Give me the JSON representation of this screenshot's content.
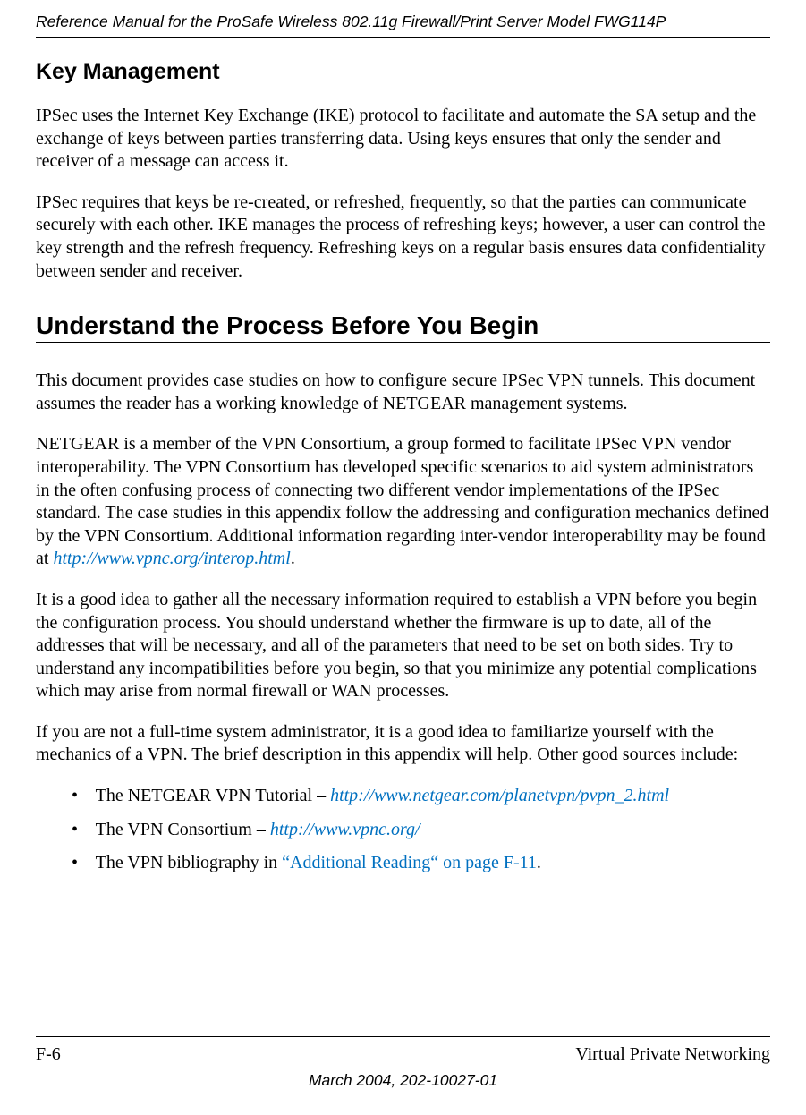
{
  "header": {
    "runningTitle": "Reference Manual for the ProSafe Wireless 802.11g  Firewall/Print Server Model FWG114P"
  },
  "sections": {
    "keyMgmt": {
      "heading": "Key Management",
      "p1": "IPSec uses the Internet Key Exchange (IKE) protocol to facilitate and automate the SA setup and the exchange of keys between parties transferring data. Using keys ensures that only the sender and receiver of a message can access it.",
      "p2": "IPSec requires that keys be re-created, or refreshed, frequently, so that the parties can communicate securely with each other. IKE manages the process of refreshing keys; however, a user can control the key strength and the refresh frequency. Refreshing keys on a regular basis ensures data confidentiality between sender and receiver."
    },
    "understand": {
      "heading": "Understand the Process Before You Begin",
      "p1": "This document provides case studies on how to configure secure IPSec VPN tunnels. This document assumes the reader has a working knowledge of NETGEAR management systems.",
      "p2a": "NETGEAR is a member of the VPN Consortium, a group formed to facilitate IPSec VPN vendor interoperability. The VPN Consortium has developed specific scenarios to aid system administrators in the often confusing process of connecting two different vendor implementations of the IPSec standard. The case studies in this appendix follow the addressing and configuration mechanics defined by the VPN Consortium. Additional information regarding inter-vendor interoperability may be found at ",
      "p2_link": "http://www.vpnc.org/interop.html",
      "p2b": ".",
      "p3": "It is a good idea to gather all the necessary information required to establish a VPN before you begin the configuration process. You should understand whether the firmware is up to date, all of the addresses that will be necessary, and all of the parameters that need to be set on both sides. Try to understand any incompatibilities before you begin, so that you minimize any potential complications which may arise from normal firewall or WAN processes.",
      "p4": "If you are not a full-time system administrator, it is a good idea to familiarize yourself with the mechanics of a VPN. The brief description in this appendix will help. Other good sources include:",
      "bullets": {
        "b1a": "The NETGEAR VPN Tutorial – ",
        "b1_link": "http://www.netgear.com/planetvpn/pvpn_2.html",
        "b2a": "The VPN Consortium – ",
        "b2_link": "http://www.vpnc.org/",
        "b3a": "The VPN bibliography in ",
        "b3_xref": "“Additional Reading“ on page F-11",
        "b3b": "."
      }
    }
  },
  "footer": {
    "pageNum": "F-6",
    "sectionTitle": "Virtual Private Networking",
    "dateLine": "March 2004, 202-10027-01"
  }
}
